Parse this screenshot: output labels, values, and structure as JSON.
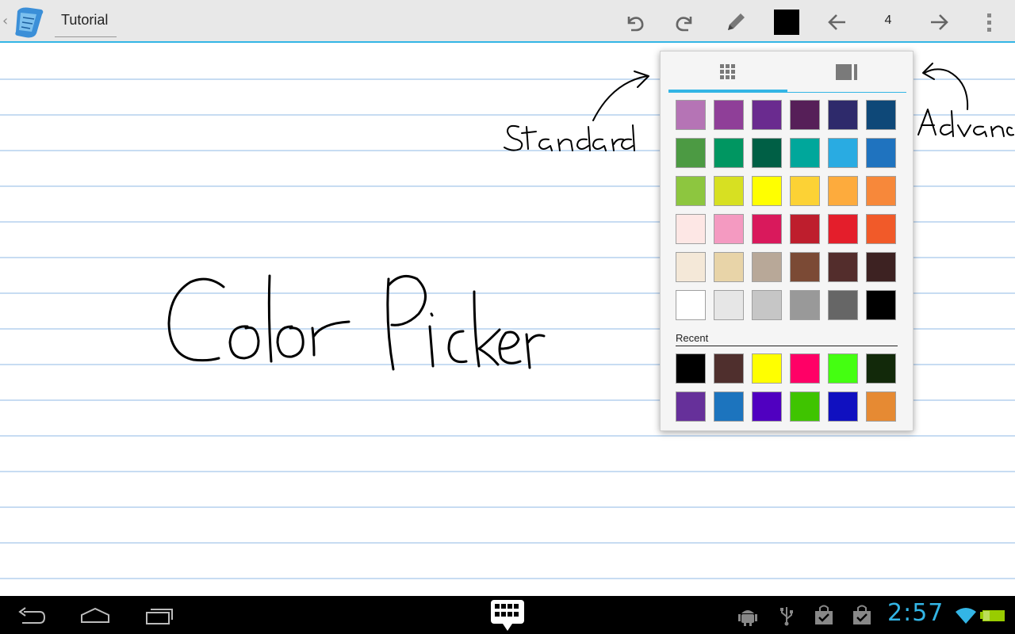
{
  "app": {
    "title": "Tutorial",
    "page_number": "4",
    "current_color": "#000000",
    "accent_color": "#33b5e5"
  },
  "toolbar": {
    "icons": [
      "back-caret-icon",
      "app-logo-icon",
      "undo-icon",
      "redo-icon",
      "pencil-icon",
      "color-swatch",
      "previous-page-icon",
      "next-page-icon",
      "overflow-menu-icon"
    ]
  },
  "canvas": {
    "handwriting": [
      "Color Picker",
      "Standard",
      "Advanced"
    ]
  },
  "color_picker": {
    "tabs": [
      {
        "name": "standard",
        "icon": "grid-icon",
        "selected": true
      },
      {
        "name": "advanced",
        "icon": "advanced-palette-icon",
        "selected": false
      }
    ],
    "standard_colors": [
      [
        "#b574b5",
        "#8f3f98",
        "#6a2b8f",
        "#561f58",
        "#2e2a6b",
        "#0e4878"
      ],
      [
        "#4c9a43",
        "#009661",
        "#005f45",
        "#00a79b",
        "#29abe2",
        "#1f73bf"
      ],
      [
        "#8dc63f",
        "#d7e022",
        "#ffff00",
        "#fcd235",
        "#fdab3d",
        "#f7883a"
      ],
      [
        "#fde7e5",
        "#f49ac1",
        "#d9195c",
        "#be1e2d",
        "#e41e2b",
        "#f15a29"
      ],
      [
        "#f4e8d8",
        "#e8d4a8",
        "#b8a898",
        "#7b4a35",
        "#532d2c",
        "#3d2222"
      ],
      [
        "#ffffff",
        "#e6e6e6",
        "#c6c6c6",
        "#999999",
        "#666666",
        "#000000"
      ]
    ],
    "recent_label": "Recent",
    "recent_colors": [
      [
        "#000000",
        "#4f2f2d",
        "#ffff00",
        "#ff0066",
        "#44ff11",
        "#12290a"
      ],
      [
        "#66309a",
        "#1c74be",
        "#5000c0",
        "#3fc400",
        "#1010c0",
        "#e68a33"
      ]
    ]
  },
  "system_bar": {
    "clock": "2:57",
    "nav_icons": [
      "back-icon",
      "home-icon",
      "recent-apps-icon"
    ],
    "center_icon": "keyboard-icon",
    "status_icons": [
      "android-debug-icon",
      "usb-icon",
      "shopping-bag-icon",
      "shopping-bag-check-icon",
      "wifi-icon",
      "battery-icon"
    ]
  }
}
